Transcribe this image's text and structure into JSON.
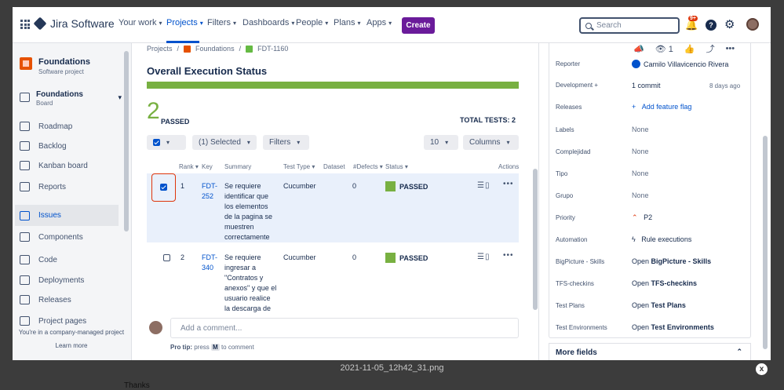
{
  "topnav": {
    "logo": "Jira Software",
    "items": [
      "Your work",
      "Projects",
      "Filters",
      "Dashboards",
      "People",
      "Plans",
      "Apps"
    ],
    "create": "Create",
    "search_placeholder": "Search",
    "notif_badge": "9+",
    "help": "?"
  },
  "sidebar": {
    "project_name": "Foundations",
    "project_type": "Software project",
    "board_name": "Foundations",
    "board_type": "Board",
    "items": [
      "Roadmap",
      "Backlog",
      "Kanban board",
      "Reports",
      "Issues",
      "Components",
      "Code",
      "Deployments",
      "Releases",
      "Project pages"
    ],
    "footer_note": "You're in a company-managed project",
    "learn_more": "Learn more"
  },
  "main": {
    "breadcrumb": [
      "Projects",
      "/",
      "Foundations",
      "/",
      "FDT-1160"
    ],
    "title": "Overall Execution Status",
    "passed_count": "2",
    "passed_label": "PASSED",
    "total_tests": "TOTAL TESTS: 2",
    "controls": {
      "selected": "(1) Selected",
      "filters": "Filters",
      "page_size": "10",
      "columns": "Columns"
    },
    "columns": [
      "Rank",
      "Key",
      "Summary",
      "Test Type",
      "Dataset",
      "#Defects",
      "Status",
      "Actions"
    ],
    "rows": [
      {
        "rank": "1",
        "key": "FDT-252",
        "summary": "Se requiere identificar que los elementos de la pagina se muestren correctamente",
        "type": "Cucumber",
        "defects": "0",
        "status": "PASSED"
      },
      {
        "rank": "2",
        "key": "FDT-340",
        "summary": "Se requiere ingresar a \"Contratos y anexos\" y que el usuario realice la descarga de un documento",
        "type": "Cucumber",
        "defects": "0",
        "status": "PASSED"
      }
    ],
    "comment_placeholder": "Add a comment...",
    "protip_a": "Pro tip:",
    "protip_b": "press",
    "protip_key": "M",
    "protip_c": "to comment"
  },
  "rpanel": {
    "watch_count": "1",
    "fields": [
      {
        "label": "Reporter",
        "value": "Camilo Villavicencio Rivera"
      },
      {
        "label": "Development",
        "value": "1 commit",
        "extra": "8 days ago"
      },
      {
        "label": "Releases",
        "value": "Add feature flag"
      },
      {
        "label": "Labels",
        "value": "None"
      },
      {
        "label": "Complejidad",
        "value": "None"
      },
      {
        "label": "Tipo",
        "value": "None"
      },
      {
        "label": "Grupo",
        "value": "None"
      },
      {
        "label": "Priority",
        "value": "P2"
      },
      {
        "label": "Automation",
        "value": "Rule executions"
      },
      {
        "label": "BigPicture - Skills",
        "value": "Open",
        "bold": "BigPicture - Skills"
      },
      {
        "label": "TFS-checkins",
        "value": "Open",
        "bold": "TFS-checkins"
      },
      {
        "label": "Test Plans",
        "value": "Open",
        "bold": "Test Plans"
      },
      {
        "label": "Test Environments",
        "value": "Open",
        "bold": "Test Environments"
      }
    ],
    "more_fields": "More fields"
  },
  "viewer": {
    "filename": "2021-11-05_12h42_31.png",
    "close": "x",
    "caption": "Thanks"
  },
  "colors": {
    "accent": "#0052cc",
    "passed": "#78b041",
    "create": "#6a1b9a",
    "highlight": "#de350b"
  }
}
